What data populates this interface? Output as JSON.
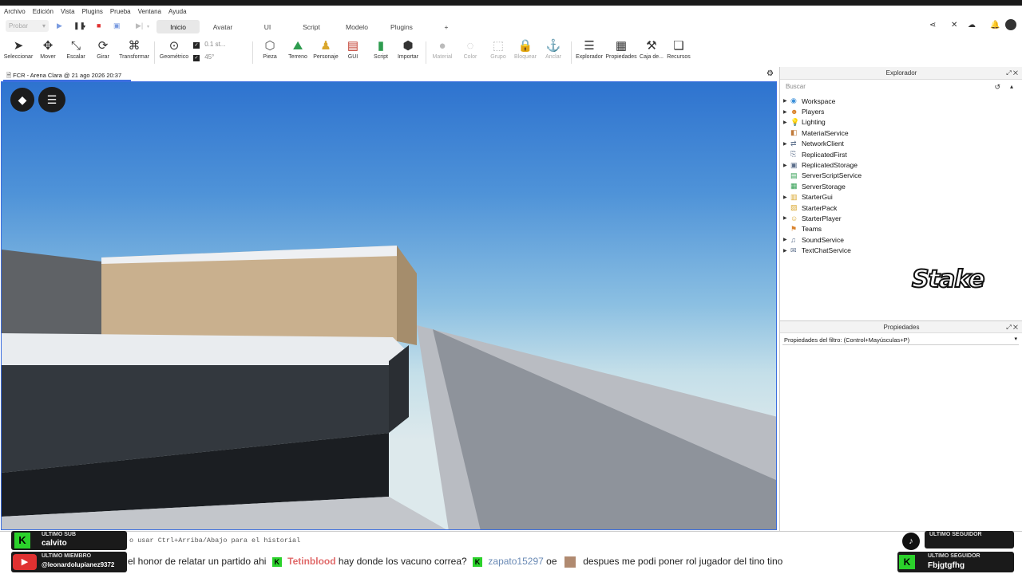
{
  "menu": [
    "Archivo",
    "Edición",
    "Vista",
    "Plugins",
    "Prueba",
    "Ventana",
    "Ayuda"
  ],
  "test_mode": "Probar",
  "ribbon_tabs": [
    "Inicio",
    "Avatar",
    "UI",
    "Script",
    "Modelo",
    "Plugins"
  ],
  "add_tab": "+",
  "tools": {
    "select": "Seleccionar",
    "move": "Mover",
    "scale": "Escalar",
    "rotate": "Girar",
    "transform": "Transformar",
    "geometric": "Geométrico",
    "move_snap": "0.1 st...",
    "rotate_snap": "45°",
    "part": "Pieza",
    "terrain": "Terreno",
    "character": "Personaje",
    "gui": "GUI",
    "script": "Script",
    "import": "Importar",
    "material": "Material",
    "color": "Color",
    "group": "Grupo",
    "lock": "Bloquear",
    "anchor": "Anclar",
    "explorer": "Explorador",
    "properties": "Propiedades",
    "toolbox": "Caja de...",
    "assets": "Recursos"
  },
  "document_tab": "FCR - Arena Clara @ 21 ago 2026 20:37",
  "explorer": {
    "title": "Explorador",
    "search_placeholder": "Buscar",
    "items": [
      {
        "label": "Workspace",
        "icon": "globe-icon",
        "expandable": true,
        "color": "#3a8fd9"
      },
      {
        "label": "Players",
        "icon": "players-icon",
        "expandable": true,
        "color": "#d9822b"
      },
      {
        "label": "Lighting",
        "icon": "bulb-icon",
        "expandable": true,
        "color": "#e3b21a"
      },
      {
        "label": "MaterialService",
        "icon": "material-icon",
        "expandable": false,
        "color": "#c07a3a"
      },
      {
        "label": "NetworkClient",
        "icon": "network-icon",
        "expandable": true,
        "color": "#5a6d8a"
      },
      {
        "label": "ReplicatedFirst",
        "icon": "replicated-first-icon",
        "expandable": false,
        "color": "#5a6d8a"
      },
      {
        "label": "ReplicatedStorage",
        "icon": "replicated-storage-icon",
        "expandable": true,
        "color": "#5a6d8a"
      },
      {
        "label": "ServerScriptService",
        "icon": "server-script-icon",
        "expandable": false,
        "color": "#2e9c4f"
      },
      {
        "label": "ServerStorage",
        "icon": "server-storage-icon",
        "expandable": false,
        "color": "#2e9c4f"
      },
      {
        "label": "StarterGui",
        "icon": "starter-gui-icon",
        "expandable": true,
        "color": "#d9a62b"
      },
      {
        "label": "StarterPack",
        "icon": "starter-pack-icon",
        "expandable": false,
        "color": "#d9a62b"
      },
      {
        "label": "StarterPlayer",
        "icon": "starter-player-icon",
        "expandable": true,
        "color": "#d9a62b"
      },
      {
        "label": "Teams",
        "icon": "teams-icon",
        "expandable": false,
        "color": "#d9822b"
      },
      {
        "label": "SoundService",
        "icon": "sound-icon",
        "expandable": true,
        "color": "#5a6d8a"
      },
      {
        "label": "TextChatService",
        "icon": "chat-icon",
        "expandable": true,
        "color": "#5a6d8a"
      }
    ]
  },
  "properties": {
    "title": "Propiedades",
    "filter_placeholder": "Propiedades del filtro: (Control+Mayúsculas+P)"
  },
  "stake_logo": "Stake",
  "command_bar": {
    "text": "o usar Ctrl+Arriba/Abajo para el historial"
  },
  "overlays": {
    "last_sub_label": "ULTIMO SUB",
    "last_sub_value": "calvito",
    "last_member_label": "ULTIMO MIEMBRO",
    "last_member_value": "@leonardolupianez9372",
    "last_follower_label_1": "ULTIMO SEGUIDOR",
    "last_follower_label_2": "ULTIMO SEGUIDOR",
    "last_follower_value": "Fbjgtgfhg"
  },
  "ticker": {
    "msg1": "el honor de relatar un partido ahi",
    "user2": "Tetinblood",
    "msg2": "hay donde los vacuno correa?",
    "user3": "zapato15297",
    "msg3": "oe",
    "msg4": "despues me podi poner rol jugador del tino tino"
  },
  "colors": {
    "accent": "#3c6ee0",
    "kick_green": "#2bd22b",
    "record_red": "#e03131"
  }
}
